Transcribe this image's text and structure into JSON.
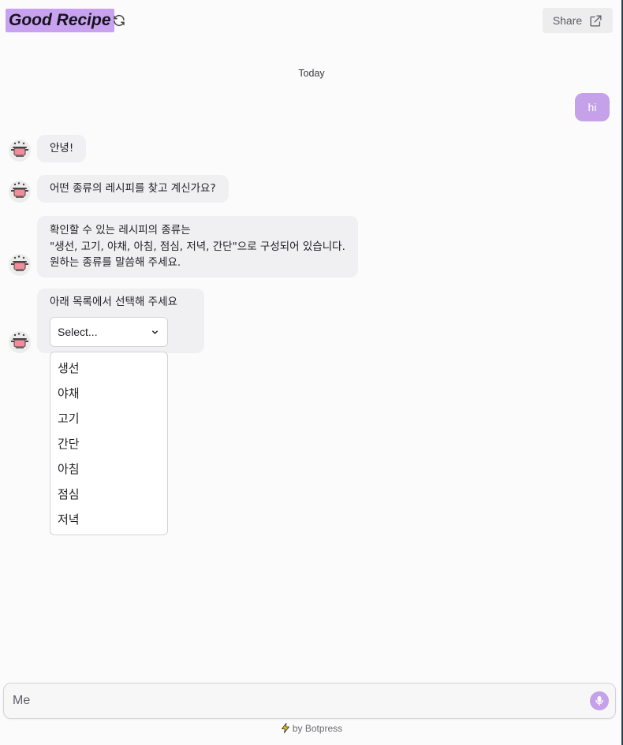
{
  "header": {
    "title": "Good Recipe",
    "share_label": "Share"
  },
  "chat": {
    "day_label": "Today",
    "user_message": "hi",
    "bot_messages": [
      "안녕!",
      "어떤 종류의 레시피를 찾고 계신가요?",
      "확인할 수 있는 레시피의 종류는",
      "\"생선, 고기, 야채, 아침, 점심, 저녁, 간단\"으로 구성되어 있습니다.",
      "원하는 종류를 말씀해 주세요.",
      "아래 목록에서 선택해 주세요"
    ],
    "select": {
      "placeholder": "Select...",
      "options": [
        "생선",
        "야채",
        "고기",
        "간단",
        "아침",
        "점심",
        "저녁"
      ]
    }
  },
  "composer": {
    "placeholder": "Me"
  },
  "footer": {
    "text": "by Botpress"
  },
  "colors": {
    "accent": "#c4a1e8",
    "title_highlight": "#c8a2f0",
    "bubble_bg": "#f0f0f3"
  }
}
